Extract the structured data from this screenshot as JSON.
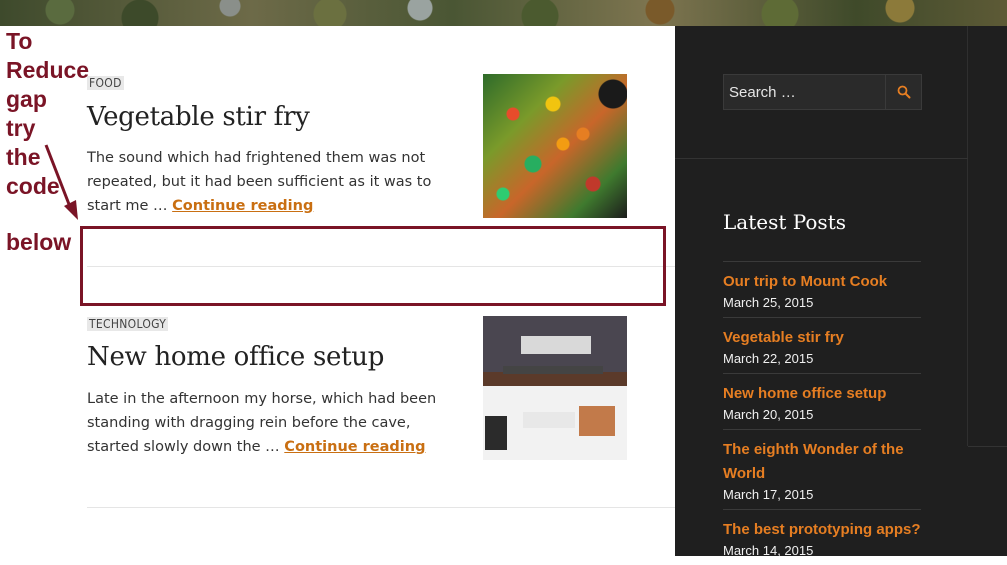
{
  "annotation": {
    "text": "To\nReduce\ngap\ntry\nthe\ncode",
    "below": "below",
    "color": "#7a1426"
  },
  "posts": [
    {
      "category": "FOOD",
      "title": "Vegetable stir fry",
      "excerpt": "The sound which had frightened them was not repeated, but it had been sufficient as it was to start me … ",
      "read_more": "Continue reading",
      "thumbnail": "vegetable-stir-fry-photo"
    },
    {
      "category": "TECHNOLOGY",
      "title": "New home office setup",
      "excerpt": "Late in the afternoon my horse, which had been standing with dragging rein before the cave, started slowly down the … ",
      "read_more": "Continue reading",
      "thumbnail": "home-office-desk-photo"
    }
  ],
  "sidebar": {
    "search": {
      "placeholder": "Search …",
      "icon": "search-icon"
    },
    "latest_posts": {
      "title": "Latest Posts",
      "items": [
        {
          "title": "Our trip to Mount Cook",
          "date": "March 25, 2015"
        },
        {
          "title": "Vegetable stir fry",
          "date": "March 22, 2015"
        },
        {
          "title": "New home office setup",
          "date": "March 20, 2015"
        },
        {
          "title": "The eighth Wonder of the World",
          "date": "March 17, 2015"
        },
        {
          "title": "The best prototyping apps?",
          "date": "March 14, 2015"
        }
      ]
    }
  },
  "colors": {
    "accent": "#e67e22",
    "link": "#c96f12",
    "sidebar_bg": "#1f1f1f"
  }
}
